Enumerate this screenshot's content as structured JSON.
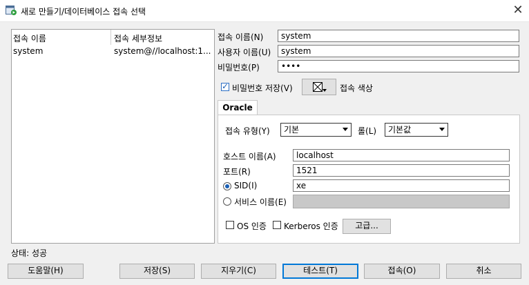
{
  "window": {
    "title": "새로 만들기/데이터베이스 접속 선택",
    "close_label": "✕"
  },
  "list": {
    "columns": [
      "접속 이름",
      "접속 세부정보"
    ],
    "rows": [
      {
        "name": "system",
        "details": "system@//localhost:1..."
      }
    ]
  },
  "form": {
    "conn_name_label": "접속 이름(N)",
    "conn_name_value": "system",
    "user_label": "사용자 이름(U)",
    "user_value": "system",
    "password_label": "비밀번호(P)",
    "password_value": "••••",
    "save_password_label": "비밀번호 저장(V)",
    "save_password_checked": true,
    "conn_color_label": "접속 색상"
  },
  "tab": {
    "label": "Oracle"
  },
  "oracle": {
    "conn_type_label": "접속 유형(Y)",
    "conn_type_value": "기본",
    "role_label": "롤(L)",
    "role_value": "기본값",
    "host_label": "호스트 이름(A)",
    "host_value": "localhost",
    "port_label": "포트(R)",
    "port_value": "1521",
    "sid_label": "SID(I)",
    "sid_value": "xe",
    "service_label": "서비스 이름(E)",
    "service_value": "",
    "os_auth_label": "OS 인증",
    "kerberos_label": "Kerberos 인증",
    "advanced_label": "고급..."
  },
  "status": {
    "text": "상태: 성공"
  },
  "buttons": {
    "help": "도움말(H)",
    "save": "저장(S)",
    "clear": "지우기(C)",
    "test": "테스트(T)",
    "connect": "접속(O)",
    "cancel": "취소"
  }
}
